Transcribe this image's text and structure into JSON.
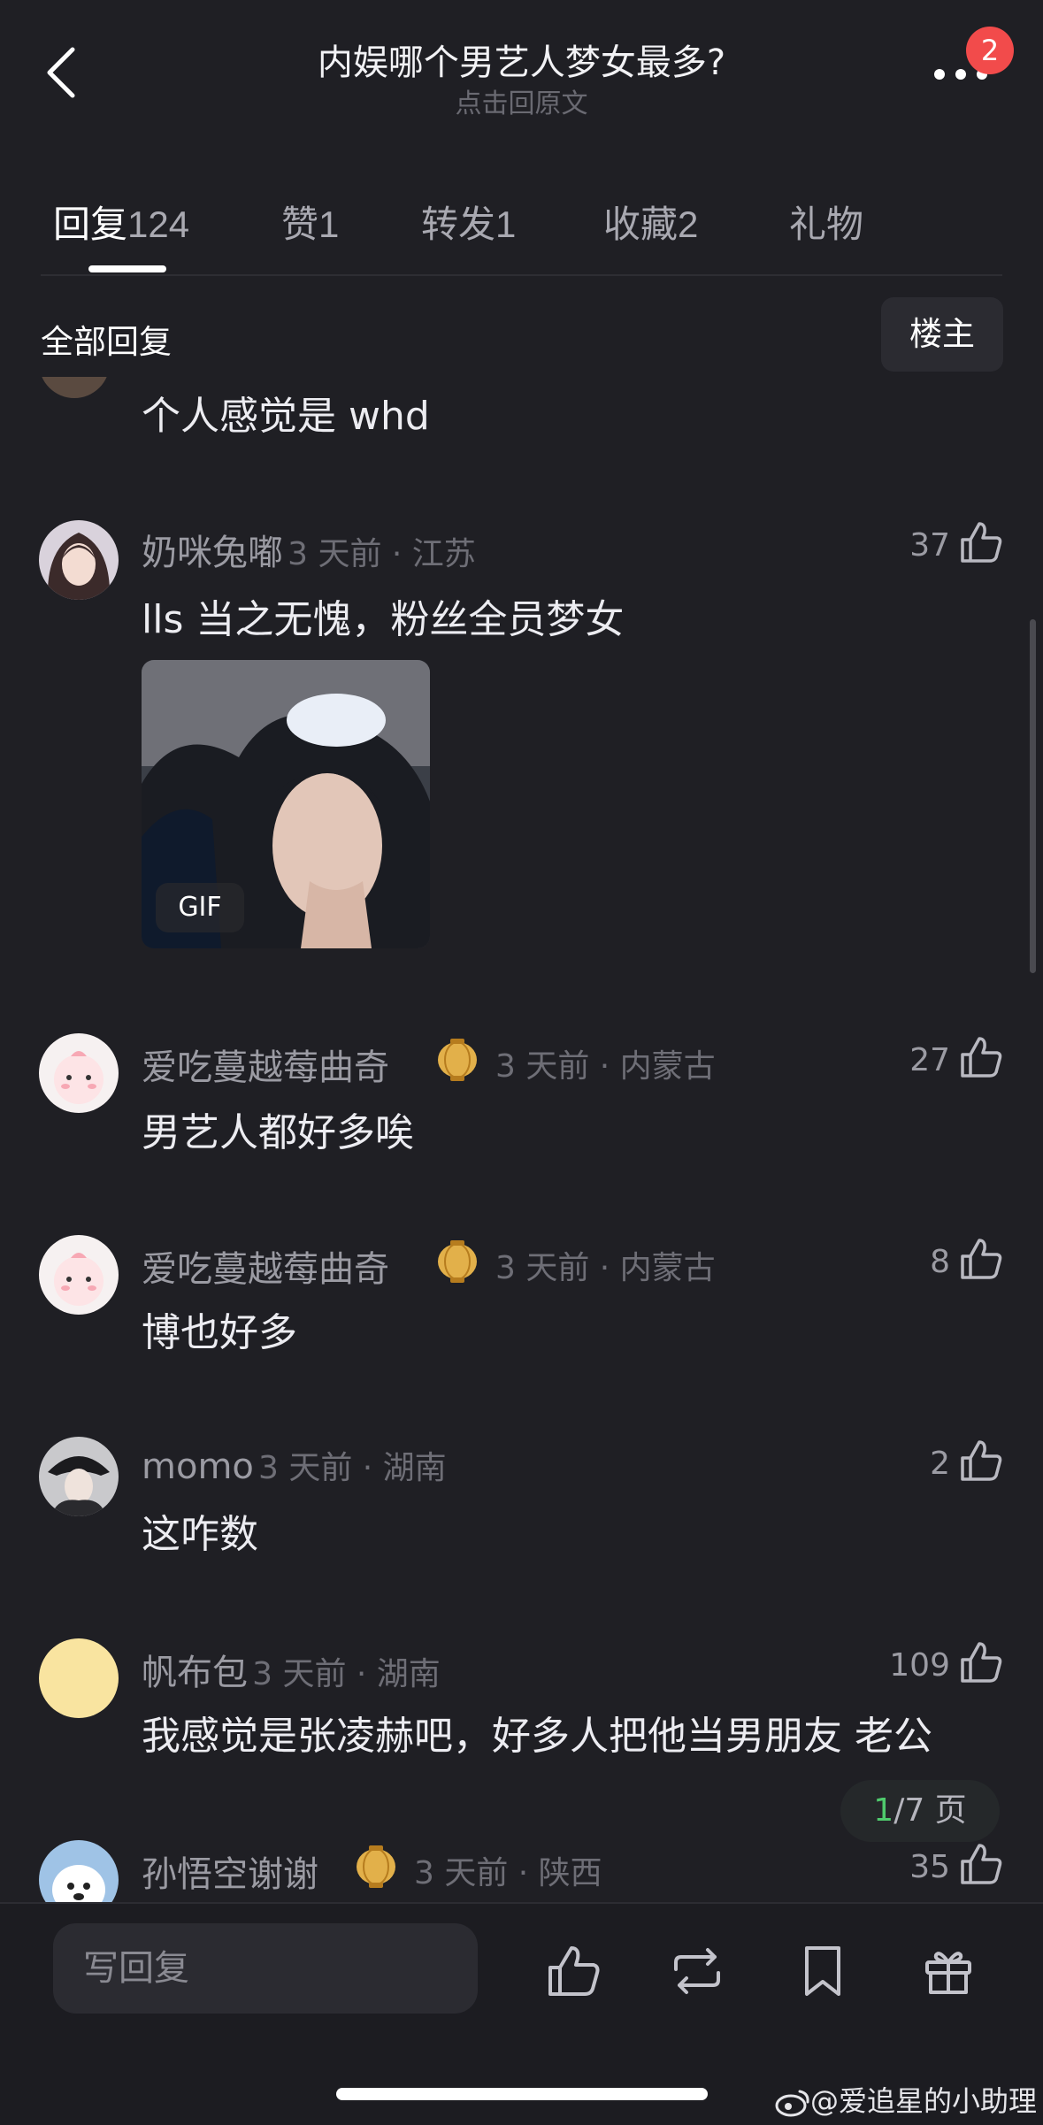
{
  "header": {
    "title": "内娱哪个男艺人梦女最多?",
    "subtitle": "点击回原文",
    "badge": "2"
  },
  "tabs": [
    {
      "label": "回复",
      "count": "124"
    },
    {
      "label": "赞",
      "count": "1"
    },
    {
      "label": "转发",
      "count": "1"
    },
    {
      "label": "收藏",
      "count": "2"
    },
    {
      "label": "礼物",
      "count": ""
    }
  ],
  "section": {
    "title": "全部回复",
    "filter": "楼主"
  },
  "comments": [
    {
      "text": "个人感觉是 whd"
    },
    {
      "username": "奶咪兔嘟",
      "meta": "3 天前 · 江苏",
      "likes": "37",
      "text": "lls 当之无愧，粉丝全员梦女",
      "image_label": "GIF"
    },
    {
      "username": "爱吃蔓越莓曲奇",
      "meta": "3 天前 · 内蒙古",
      "likes": "27",
      "text": "男艺人都好多唉"
    },
    {
      "username": "爱吃蔓越莓曲奇",
      "meta": "3 天前 · 内蒙古",
      "likes": "8",
      "text": "博也好多"
    },
    {
      "username": "momo",
      "meta": "3 天前 · 湖南",
      "likes": "2",
      "text": "这咋数"
    },
    {
      "username": "帆布包",
      "meta": "3 天前 · 湖南",
      "likes": "109",
      "text": "我感觉是张凌赫吧，好多人把他当男朋友 老公"
    },
    {
      "username": "孙悟空谢谢",
      "meta": "3 天前 · 陕西",
      "likes": "35"
    }
  ],
  "pager": {
    "current": "1",
    "total": "/7 页"
  },
  "bottom": {
    "reply_placeholder": "写回复"
  },
  "watermark": "@爱追星的小助理",
  "colors": {
    "background": "#1f1f24",
    "badge": "#f24b4b",
    "pager_current": "#4fca6d"
  }
}
